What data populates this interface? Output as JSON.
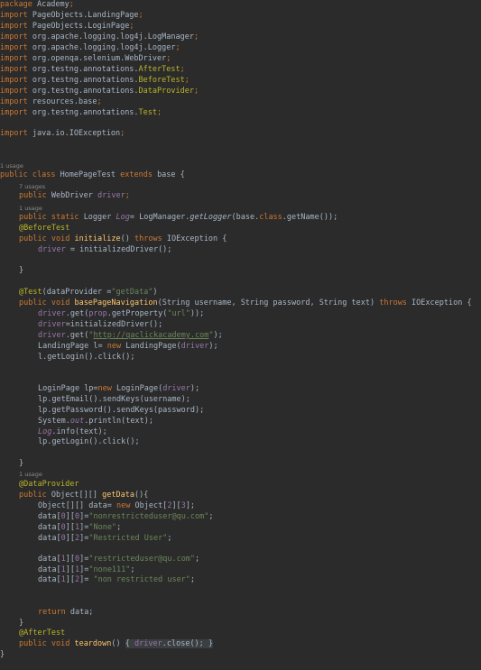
{
  "lines": {
    "pkg": "Academy",
    "imp1": "PageObjects.LandingPage",
    "imp2": "PageObjects.LoginPage",
    "imp3": "org.apache.logging.log4j.LogManager",
    "imp4": "org.apache.logging.log4j.Logger",
    "imp5": "org.openqa.selenium.WebDriver",
    "imp6a": "org.testng.annotations.",
    "imp6b": "AfterTest",
    "imp7a": "org.testng.annotations.",
    "imp7b": "BeforeTest",
    "imp8a": "org.testng.annotations.",
    "imp8b": "DataProvider",
    "imp9": "resources.base",
    "imp10a": "org.testng.annotations.",
    "imp10b": "Test",
    "imp11": "java.io.IOException",
    "hint_1usage": "1 usage",
    "hint_7usages": "7 usages",
    "class_name": "HomePageTest",
    "class_extends": "base {",
    "drv_type": "WebDriver",
    "drv_name": "driver",
    "log_type": "Logger",
    "log_name": "Log",
    "log_rhs_a": "= LogManager.",
    "log_rhs_b": "getLogger",
    "log_rhs_c": "(base.",
    "log_rhs_d": "class",
    "log_rhs_e": ".getName());",
    "ann_before": "@BeforeTest",
    "init_name": "initialize",
    "init_sig": "() ",
    "throws": "throws",
    "ioex": " IOException {",
    "init_body_a": "driver",
    "init_body_b": " = initializedDriver();",
    "close_brace": "}",
    "ann_test_a": "@Test",
    "ann_test_b": "(dataProvider =",
    "ann_test_c": "\"getData\"",
    "ann_test_d": ")",
    "nav_name": "basePageNavigation",
    "nav_params": "(String username, String password, String text) ",
    "nav_ioex": " IOException {",
    "b1_a": "driver",
    "b1_b": ".get(",
    "b1_c": "prop",
    "b1_d": ".getProperty(",
    "b1_e": "\"url\"",
    "b1_f": "));",
    "b2_a": "driver",
    "b2_b": "=initializedDriver();",
    "b3_a": "driver",
    "b3_b": ".get(",
    "b3_q1": "\"",
    "b3_url": "http://qaclickacademy.com",
    "b3_q2": "\"",
    "b3_c": ");",
    "b4_a": "LandingPage l= ",
    "b4_new": "new",
    "b4_b": " LandingPage(",
    "b4_c": "driver",
    "b4_d": ");",
    "b5": "l.getLogin().click();",
    "b6_a": "LoginPage lp=",
    "b6_new": "new",
    "b6_b": " LoginPage(",
    "b6_c": "driver",
    "b6_d": ");",
    "b7": "lp.getEmail().sendKeys(username);",
    "b8": "lp.getPassword().sendKeys(password);",
    "b9_a": "System.",
    "b9_b": "out",
    "b9_c": ".println(text);",
    "b10_a": "Log",
    "b10_b": ".info(text);",
    "b11": "lp.getLogin().click();",
    "ann_dp": "@DataProvider",
    "gd_type": "Object[][] ",
    "gd_name": "getData",
    "gd_sig": "(){",
    "d0_a": "Object[][] data= ",
    "d0_new": "new",
    "d0_b": " Object[",
    "d0_n1": "2",
    "d0_c": "][",
    "d0_n2": "3",
    "d0_d": "];",
    "r00_a": "data[",
    "r00_i": "0",
    "r00_b": "][",
    "r00_j": "0",
    "r00_c": "]=",
    "r00_v": "\"nonrestricteduser@qu.com\"",
    "r00_e": ";",
    "r01_a": "data[",
    "r01_i": "0",
    "r01_b": "][",
    "r01_j": "1",
    "r01_c": "]=",
    "r01_v": "\"None\"",
    "r01_e": ";",
    "r02_a": "data[",
    "r02_i": "0",
    "r02_b": "][",
    "r02_j": "2",
    "r02_c": "]=",
    "r02_v": "\"Restricted User\"",
    "r02_e": ";",
    "r10_a": "data[",
    "r10_i": "1",
    "r10_b": "][",
    "r10_j": "0",
    "r10_c": "]=",
    "r10_v": "\"restricteduser@qu.com\"",
    "r10_e": ";",
    "r11_a": "data[",
    "r11_i": "1",
    "r11_b": "][",
    "r11_j": "1",
    "r11_c": "]=",
    "r11_v": "\"none111\"",
    "r11_e": ";",
    "r12_a": "data[",
    "r12_i": "1",
    "r12_b": "][",
    "r12_j": "2",
    "r12_c": "]= ",
    "r12_v": "\"non restricted user\"",
    "r12_e": ";",
    "ret_kw": "return",
    "ret_b": " data;",
    "ann_after": "@AfterTest",
    "td_name": "teardown",
    "td_sig": "() ",
    "td_open": "{ ",
    "td_body_a": "driver",
    "td_body_b": ".close(); ",
    "td_close": "}"
  },
  "keywords": {
    "package": "package",
    "import": "import",
    "public": "public",
    "class": "class",
    "extends": "extends",
    "static": "static",
    "void": "void",
    "new": "new"
  },
  "colors": {
    "background": "#2b2b2b",
    "text": "#a9b7c6",
    "keyword": "#cc7832",
    "string": "#6a8759",
    "annotation": "#bbb529",
    "field": "#9876aa",
    "method": "#ffc66d",
    "hint": "#8a8a8a"
  }
}
